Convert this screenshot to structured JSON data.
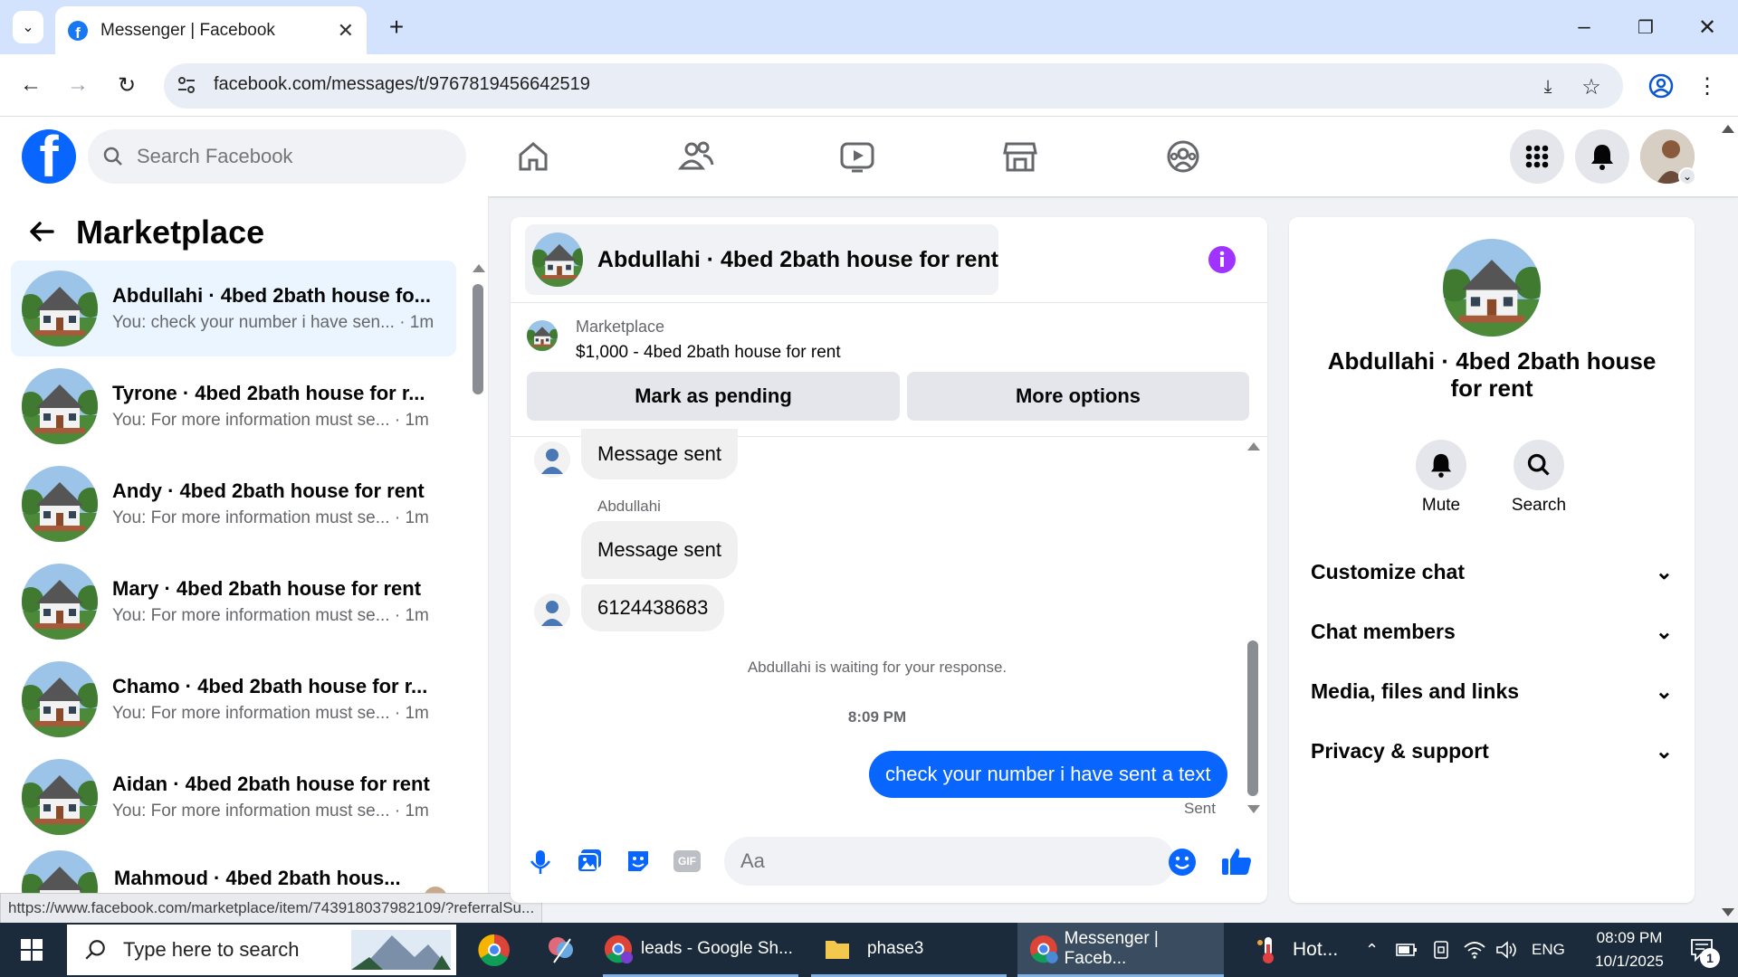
{
  "browser": {
    "tab_title": "Messenger | Facebook",
    "url": "facebook.com/messages/t/9767819456642519",
    "status_url": "https://www.facebook.com/marketplace/item/743918037982109/?referralSu..."
  },
  "fb": {
    "search_placeholder": "Search Facebook"
  },
  "left": {
    "title": "Marketplace",
    "conversations": [
      {
        "name": "Abdullahi · 4bed 2bath house fo...",
        "preview": "You: check your number i have sen... · 1m"
      },
      {
        "name": "Tyrone · 4bed 2bath house for r...",
        "preview": "You: For more information must se... · 1m"
      },
      {
        "name": "Andy · 4bed 2bath house for rent",
        "preview": "You: For more information must se... · 1m"
      },
      {
        "name": "Mary · 4bed 2bath house for rent",
        "preview": "You: For more information must se... · 1m"
      },
      {
        "name": "Chamo · 4bed 2bath house for r...",
        "preview": "You: For more information must se... · 1m"
      },
      {
        "name": "Aidan · 4bed 2bath house for rent",
        "preview": "You: For more information must se... · 1m"
      },
      {
        "name": "Mahmoud · 4bed 2bath hous...",
        "preview": ""
      }
    ]
  },
  "chat": {
    "title": "Abdullahi · 4bed 2bath house for rent",
    "listing_label": "Marketplace",
    "listing_title": "$1,000 - 4bed 2bath house for rent",
    "mark_pending": "Mark as pending",
    "more_options": "More options",
    "msg1": "Message sent",
    "sender": "Abdullahi",
    "msg2": "Message sent",
    "msg3": "6124438683",
    "waiting": "Abdullahi is waiting for your response.",
    "time": "8:09 PM",
    "out_msg": "check your number i have sent a text",
    "sent": "Sent",
    "input_placeholder": "Aa"
  },
  "right": {
    "name": "Abdullahi · 4bed 2bath house for rent",
    "mute": "Mute",
    "search": "Search",
    "sections": [
      "Customize chat",
      "Chat members",
      "Media, files and links",
      "Privacy & support"
    ]
  },
  "taskbar": {
    "search_placeholder": "Type here to search",
    "app1": "leads - Google Sh...",
    "app2": "phase3",
    "app3": "Messenger | Faceb...",
    "weather": "Hot...",
    "lang": "ENG",
    "time": "08:09 PM",
    "date": "10/1/2025",
    "notif_count": "1"
  },
  "colors": {
    "fb_blue": "#0866ff",
    "info_purple": "#a033ff",
    "tabstrip": "#d3e3fd",
    "taskbar": "#1b2b3c"
  }
}
